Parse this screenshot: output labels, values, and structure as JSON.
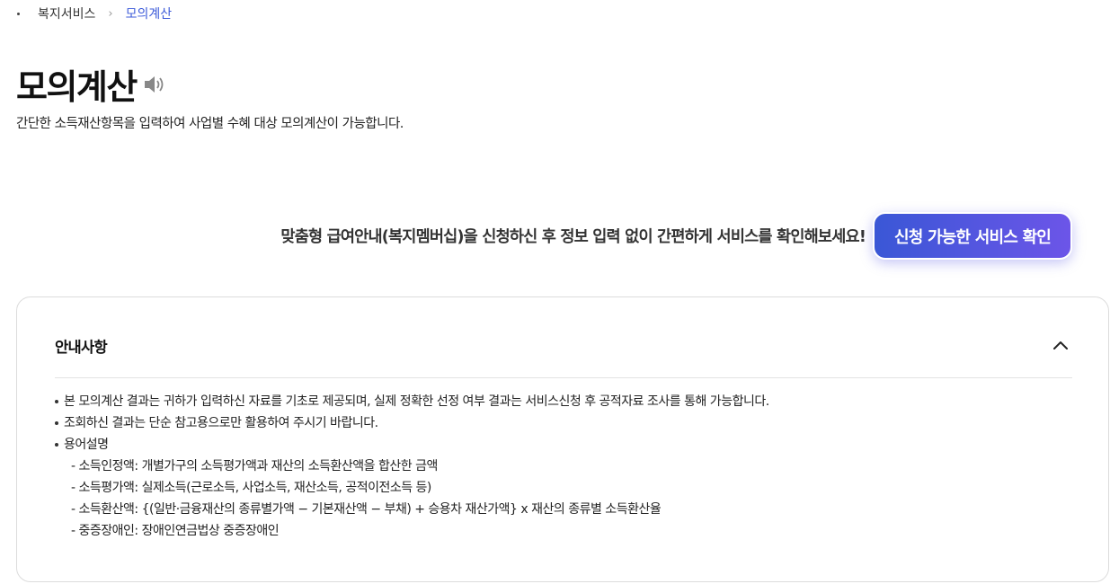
{
  "breadcrumb": {
    "items": [
      "복지서비스"
    ],
    "current": "모의계산"
  },
  "page": {
    "title": "모의계산",
    "description": "간단한 소득재산항목을 입력하여 사업별 수혜 대상 모의계산이 가능합니다."
  },
  "promo": {
    "text": "맞춤형 급여안내(복지멤버십)을 신청하신 후 정보 입력 없이 간편하게 서비스를 확인해보세요!",
    "button_label": "신청 가능한 서비스 확인"
  },
  "notice": {
    "title": "안내사항",
    "items": [
      "본 모의계산 결과는 귀하가 입력하신 자료를 기초로 제공되며, 실제 정확한 선정 여부 결과는 서비스신청 후 공적자료 조사를 통해 가능합니다.",
      "조회하신 결과는 단순 참고용으로만 활용하여 주시기 바랍니다.",
      "용어설명"
    ],
    "terms": [
      "소득인정액: 개별가구의 소득평가액과 재산의 소득환산액을 합산한 금액",
      "소득평가액: 실제소득(근로소득, 사업소득, 재산소득, 공적이전소득 등)",
      "소득환산액: {(일반·금융재산의 종류별가액 − 기본재산액 − 부채) + 승용차 재산가액} x 재산의 종류별 소득환산율",
      "중증장애인: 장애인연금법상 중증장애인"
    ]
  },
  "colors": {
    "accent": "#3d5bd9",
    "button_gradient_start": "#3a57d6",
    "button_gradient_end": "#6c55e8"
  },
  "icons": {
    "speaker": "speaker-icon",
    "collapse": "chevron-up-icon",
    "breadcrumb_separator": "chevron-right-icon"
  }
}
